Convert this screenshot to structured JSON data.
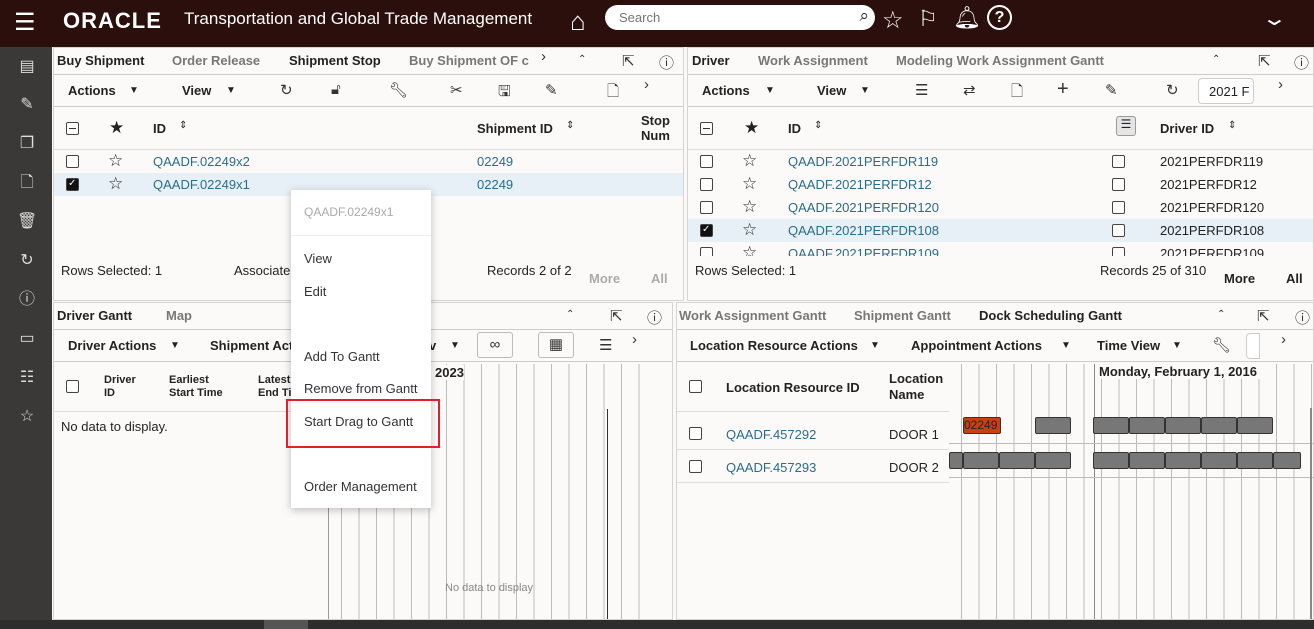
{
  "header": {
    "brand": "ORACLE",
    "title": "Transportation and Global Trade Management",
    "search_placeholder": "Search"
  },
  "sidebar": {
    "icons": [
      "panels-icon",
      "edit-list-icon",
      "copy-icon",
      "edit-doc-icon",
      "trash-icon",
      "refresh-icon",
      "info-icon",
      "monitor-icon",
      "search-list-icon",
      "star-icon"
    ]
  },
  "top_left": {
    "tabs": [
      "Buy Shipment",
      "Order Release",
      "Shipment Stop",
      "Buy Shipment OF c"
    ],
    "toolbar": {
      "actions": "Actions",
      "view": "View"
    },
    "columns": {
      "id": "ID",
      "shipment_id": "Shipment ID",
      "stop_num_1": "Stop",
      "stop_num_2": "Num"
    },
    "rows": [
      {
        "id": "QAADF.02249x2",
        "shipment_id": "02249",
        "checked": false
      },
      {
        "id": "QAADF.02249x1",
        "shipment_id": "02249",
        "checked": true
      }
    ],
    "footer": {
      "rows_selected": "Rows Selected: 1",
      "associate": "Associate",
      "records": "Records 2 of 2",
      "more": "More",
      "all": "All"
    }
  },
  "top_right": {
    "tabs": [
      "Driver",
      "Work Assignment",
      "Modeling Work Assignment Gantt"
    ],
    "toolbar": {
      "actions": "Actions",
      "view": "View",
      "field_value": "2021 F"
    },
    "columns": {
      "id": "ID",
      "driver_id": "Driver ID"
    },
    "rows": [
      {
        "id": "QAADF.2021PERFDR119",
        "driver_id": "2021PERFDR119",
        "checked": false
      },
      {
        "id": "QAADF.2021PERFDR12",
        "driver_id": "2021PERFDR12",
        "checked": false
      },
      {
        "id": "QAADF.2021PERFDR120",
        "driver_id": "2021PERFDR120",
        "checked": false
      },
      {
        "id": "QAADF.2021PERFDR108",
        "driver_id": "2021PERFDR108",
        "checked": true
      },
      {
        "id": "QAADF.2021PERFDR109",
        "driver_id": "2021PERFDR109",
        "checked": false
      }
    ],
    "footer": {
      "rows_selected": "Rows Selected: 1",
      "records": "Records 25 of 310",
      "more": "More",
      "all": "All"
    }
  },
  "bottom_left": {
    "tabs": [
      "Driver Gantt",
      "Map"
    ],
    "toolbar": {
      "driver_actions": "Driver Actions",
      "shipment_actions": "Shipment Act",
      "view_tail": "v"
    },
    "columns": {
      "driver_id_1": "Driver",
      "driver_id_2": "ID",
      "earliest_1": "Earliest",
      "earliest_2": "Start Time",
      "latest_1": "Latest",
      "latest_2": "End Ti"
    },
    "empty": "No data to display.",
    "gantt_year": "2023",
    "gantt_empty": "No data to display"
  },
  "bottom_right": {
    "tabs": [
      "Work Assignment Gantt",
      "Shipment Gantt",
      "Dock Scheduling Gantt"
    ],
    "toolbar": {
      "location_actions": "Location Resource Actions",
      "appointment_actions": "Appointment Actions",
      "time_view": "Time View"
    },
    "columns": {
      "loc_id": "Location Resource ID",
      "loc_name_1": "Location",
      "loc_name_2": "Name"
    },
    "date": "Monday, February 1, 2016",
    "rows": [
      {
        "id": "QAADF.457292",
        "name": "DOOR 1"
      },
      {
        "id": "QAADF.457293",
        "name": "DOOR 2"
      }
    ],
    "appointment_label": "02249",
    "colors": {
      "appointment_highlight": "#c8400f",
      "appointment": "#777777"
    }
  },
  "context_menu": {
    "title": "QAADF.02249x1",
    "items": [
      "View",
      "Edit",
      "Add To Gantt",
      "Remove from Gantt",
      "Start Drag to Gantt",
      "Order Management"
    ],
    "highlighted": "Start Drag to Gantt",
    "highlight_color": "#e0202a"
  }
}
